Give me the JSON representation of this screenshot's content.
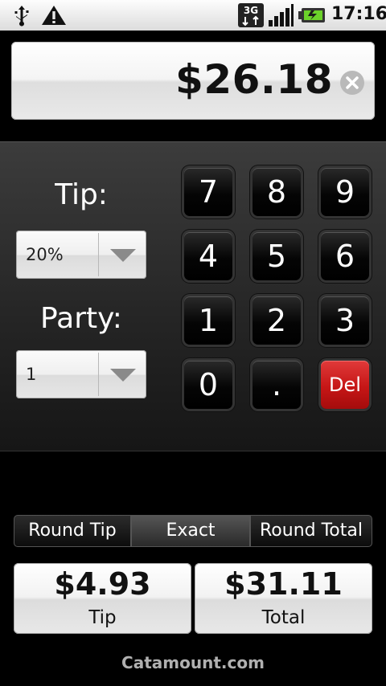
{
  "status_bar": {
    "time": "17:16",
    "network_label": "3G",
    "icons": [
      "usb-icon",
      "warning-icon",
      "3g-data-icon",
      "signal-icon",
      "battery-charging-icon"
    ]
  },
  "amount": {
    "value": "$26.18"
  },
  "tip": {
    "label": "Tip:",
    "selected": "20%"
  },
  "party": {
    "label": "Party:",
    "selected": "1"
  },
  "keypad": {
    "keys": [
      "7",
      "8",
      "9",
      "4",
      "5",
      "6",
      "1",
      "2",
      "3",
      "0",
      ".",
      "Del"
    ]
  },
  "rounding": {
    "options": [
      "Round Tip",
      "Exact",
      "Round Total"
    ],
    "selected": "Exact"
  },
  "results": {
    "tip_amount": "$4.93",
    "tip_label": "Tip",
    "total_amount": "$31.11",
    "total_label": "Total"
  },
  "footer": {
    "text": "Catamount.com"
  },
  "colors": {
    "delete_key": "#c61616",
    "keypad_key": "#000000",
    "background": "#000000"
  }
}
